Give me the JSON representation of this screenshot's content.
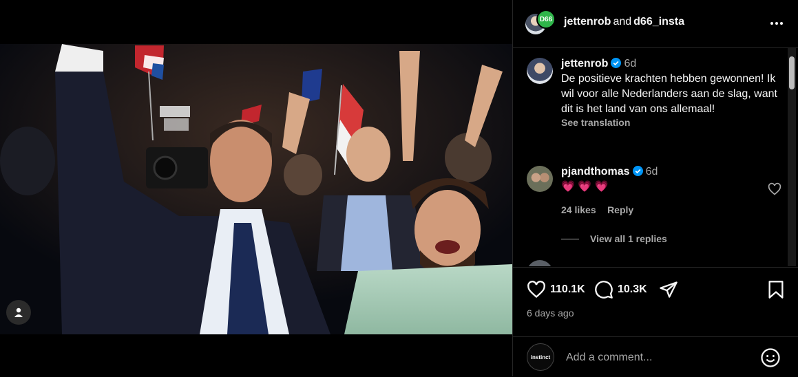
{
  "header": {
    "user1": "jettenrob",
    "and_text": "and",
    "user2": "d66_insta",
    "badge_text": "D66"
  },
  "comments": [
    {
      "username": "jettenrob",
      "time": "6d",
      "text": "De positieve krachten hebben gewonnen! Ik wil voor alle Nederlanders aan de slag, want dit is het land van ons allemaal!",
      "see_translation": "See translation"
    },
    {
      "username": "pjandthomas",
      "time": "6d",
      "text": "💗 💗 💗",
      "likes": "24 likes",
      "reply": "Reply",
      "view_replies": "View all 1 replies"
    }
  ],
  "actions": {
    "likes": "110.1K",
    "comments": "10.3K",
    "posted": "6 days ago"
  },
  "composer": {
    "avatar_text": "instinct",
    "placeholder": "Add a comment..."
  },
  "colors": {
    "background": "#000000",
    "text": "#f5f5f5",
    "secondary_text": "#a8a8a8",
    "verified": "#0095f6",
    "badge": "#2fb54a",
    "heart_emoji": "#ff4f8b"
  }
}
